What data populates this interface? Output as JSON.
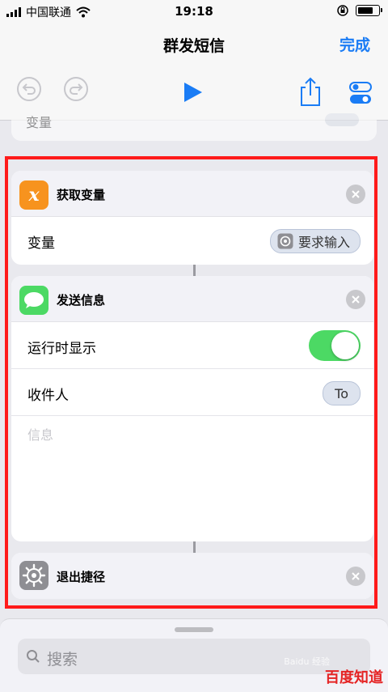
{
  "status": {
    "carrier": "中国联通",
    "time": "19:18"
  },
  "nav": {
    "title": "群发短信",
    "done": "完成"
  },
  "prev_card": {
    "label": "变量"
  },
  "cards": {
    "get_variable": {
      "title": "获取变量",
      "row_label": "变量",
      "token": "要求输入",
      "icon_letter": "x"
    },
    "send_message": {
      "title": "发送信息",
      "show_when_run": "运行时显示",
      "show_when_run_on": true,
      "recipients_label": "收件人",
      "recipients_token": "To",
      "message_placeholder": "信息"
    },
    "exit_shortcut": {
      "title": "退出捷径"
    }
  },
  "search": {
    "placeholder": "搜索"
  },
  "watermark": {
    "text": "百度知道",
    "subtext": "Baidu 经验"
  },
  "colors": {
    "accent": "#1a7cf5",
    "toggle_on": "#4cd964",
    "highlight": "#ff1a1a"
  }
}
